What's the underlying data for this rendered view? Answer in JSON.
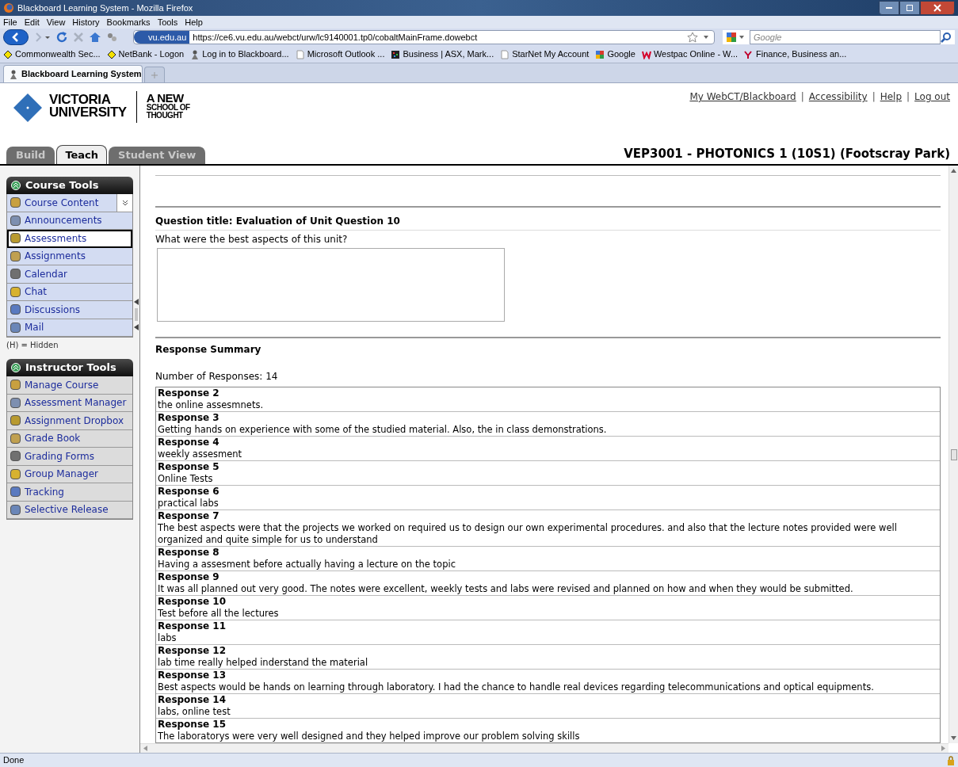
{
  "window": {
    "title": "Blackboard Learning System - Mozilla Firefox"
  },
  "menu": [
    "File",
    "Edit",
    "View",
    "History",
    "Bookmarks",
    "Tools",
    "Help"
  ],
  "toolbar": {
    "site_badge": "vu.edu.au",
    "url": "https://ce6.vu.edu.au/webct/urw/lc9140001.tp0/cobaltMainFrame.dowebct",
    "search_placeholder": "Google"
  },
  "bookmarks": [
    {
      "label": "Commonwealth Sec...",
      "kind": "diamond"
    },
    {
      "label": "NetBank - Logon",
      "kind": "diamond"
    },
    {
      "label": "Log in to Blackboard...",
      "kind": "person"
    },
    {
      "label": "Microsoft Outlook ...",
      "kind": "page"
    },
    {
      "label": "Business | ASX, Mark...",
      "kind": "grid"
    },
    {
      "label": "StarNet My Account",
      "kind": "page"
    },
    {
      "label": "Google",
      "kind": "google"
    },
    {
      "label": "Westpac Online - W...",
      "kind": "westpac"
    },
    {
      "label": "Finance, Business an...",
      "kind": "yahoo"
    }
  ],
  "browser_tabs": [
    {
      "label": "Blackboard Learning System",
      "selected": true
    }
  ],
  "header": {
    "logo_lines": [
      "VICTORIA",
      "UNIVERSITY"
    ],
    "tagline_lines": [
      "A NEW",
      "SCHOOL OF",
      "THOUGHT"
    ],
    "links": [
      "My WebCT/Blackboard",
      "Accessibility",
      "Help",
      "Log out"
    ],
    "link_separator": "|",
    "tabs": [
      {
        "label": "Build",
        "selected": false
      },
      {
        "label": "Teach",
        "selected": true
      },
      {
        "label": "Student View",
        "selected": false
      }
    ],
    "course_title": "VEP3001 - PHOTONICS 1 (10S1) (Footscray Park)"
  },
  "sidebar": {
    "groups": [
      {
        "title": "Course Tools",
        "items": [
          {
            "label": "Course Content",
            "selected": false
          },
          {
            "label": "Announcements",
            "selected": false
          },
          {
            "label": "Assessments",
            "selected": true
          },
          {
            "label": "Assignments",
            "selected": false
          },
          {
            "label": "Calendar",
            "selected": false
          },
          {
            "label": "Chat",
            "selected": false
          },
          {
            "label": "Discussions",
            "selected": false
          },
          {
            "label": "Mail",
            "selected": false
          }
        ],
        "note": "(H) = Hidden"
      },
      {
        "title": "Instructor Tools",
        "items": [
          {
            "label": "Manage Course",
            "selected": false
          },
          {
            "label": "Assessment Manager",
            "selected": false
          },
          {
            "label": "Assignment Dropbox",
            "selected": false
          },
          {
            "label": "Grade Book",
            "selected": false
          },
          {
            "label": "Grading Forms",
            "selected": false
          },
          {
            "label": "Group Manager",
            "selected": false
          },
          {
            "label": "Tracking",
            "selected": false
          },
          {
            "label": "Selective Release",
            "selected": false
          }
        ]
      }
    ]
  },
  "content": {
    "question_title": "Question title: Evaluation of Unit Question 10",
    "question_text": "What were the best aspects of this unit?",
    "summary_heading": "Response Summary",
    "count_label": "Number of Responses: 14",
    "responses": [
      {
        "title": "Response 2",
        "text": "the online assesmnets."
      },
      {
        "title": "Response 3",
        "text": "Getting hands on experience with some of the studied material. Also, the in class demonstrations."
      },
      {
        "title": "Response 4",
        "text": "weekly assesment"
      },
      {
        "title": "Response 5",
        "text": "Online Tests"
      },
      {
        "title": "Response 6",
        "text": "practical labs"
      },
      {
        "title": "Response 7",
        "text": "The best aspects were that the projects we worked on required us to design our own experimental procedures. and also that the lecture notes provided were well organized and quite simple for us to understand"
      },
      {
        "title": "Response 8",
        "text": "Having a assesment before actually having a lecture on the topic"
      },
      {
        "title": "Response 9",
        "text": "It was all planned out very good. The notes were excellent, weekly tests and labs were revised and planned on how and when they would be submitted."
      },
      {
        "title": "Response 10",
        "text": "Test before all the lectures"
      },
      {
        "title": "Response 11",
        "text": "labs"
      },
      {
        "title": "Response 12",
        "text": "lab time really helped inderstand the material"
      },
      {
        "title": "Response 13",
        "text": "Best aspects would be hands on learning through laboratory. I had the chance to handle real devices regarding telecommunications and optical equipments."
      },
      {
        "title": "Response 14",
        "text": "labs, online test"
      },
      {
        "title": "Response 15",
        "text": "The laboratorys were very well designed and they helped improve our problem solving skills"
      }
    ]
  },
  "status_bar": "Done"
}
